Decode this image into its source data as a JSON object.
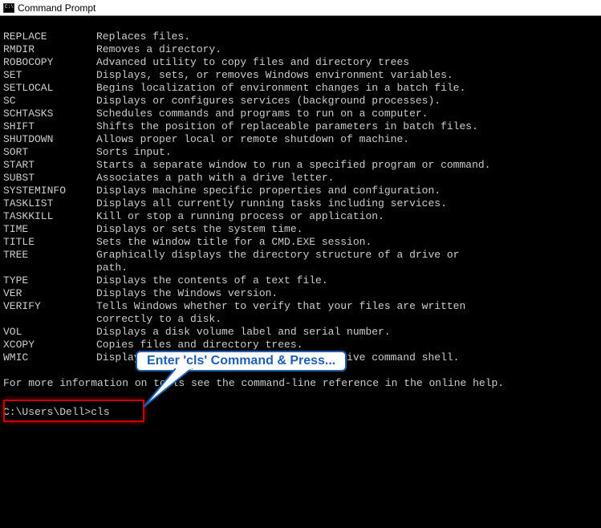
{
  "window": {
    "title": "Command Prompt"
  },
  "commands": [
    {
      "name": "REPLACE",
      "desc": "Replaces files."
    },
    {
      "name": "RMDIR",
      "desc": "Removes a directory."
    },
    {
      "name": "ROBOCOPY",
      "desc": "Advanced utility to copy files and directory trees"
    },
    {
      "name": "SET",
      "desc": "Displays, sets, or removes Windows environment variables."
    },
    {
      "name": "SETLOCAL",
      "desc": "Begins localization of environment changes in a batch file."
    },
    {
      "name": "SC",
      "desc": "Displays or configures services (background processes)."
    },
    {
      "name": "SCHTASKS",
      "desc": "Schedules commands and programs to run on a computer."
    },
    {
      "name": "SHIFT",
      "desc": "Shifts the position of replaceable parameters in batch files."
    },
    {
      "name": "SHUTDOWN",
      "desc": "Allows proper local or remote shutdown of machine."
    },
    {
      "name": "SORT",
      "desc": "Sorts input."
    },
    {
      "name": "START",
      "desc": "Starts a separate window to run a specified program or command."
    },
    {
      "name": "SUBST",
      "desc": "Associates a path with a drive letter."
    },
    {
      "name": "SYSTEMINFO",
      "desc": "Displays machine specific properties and configuration."
    },
    {
      "name": "TASKLIST",
      "desc": "Displays all currently running tasks including services."
    },
    {
      "name": "TASKKILL",
      "desc": "Kill or stop a running process or application."
    },
    {
      "name": "TIME",
      "desc": "Displays or sets the system time."
    },
    {
      "name": "TITLE",
      "desc": "Sets the window title for a CMD.EXE session."
    },
    {
      "name": "TREE",
      "desc": "Graphically displays the directory structure of a drive or",
      "cont": "path."
    },
    {
      "name": "TYPE",
      "desc": "Displays the contents of a text file."
    },
    {
      "name": "VER",
      "desc": "Displays the Windows version."
    },
    {
      "name": "VERIFY",
      "desc": "Tells Windows whether to verify that your files are written",
      "cont": "correctly to a disk."
    },
    {
      "name": "VOL",
      "desc": "Displays a disk volume label and serial number."
    },
    {
      "name": "XCOPY",
      "desc": "Copies files and directory trees."
    },
    {
      "name": "WMIC",
      "desc": "Displays WMI information inside interactive command shell."
    }
  ],
  "footer": "For more information on tools see the command-line reference in the online help.",
  "prompt": {
    "path": "C:\\Users\\Dell>",
    "command": "cls"
  },
  "callout": {
    "text": "Enter 'cls' Command & Press..."
  }
}
